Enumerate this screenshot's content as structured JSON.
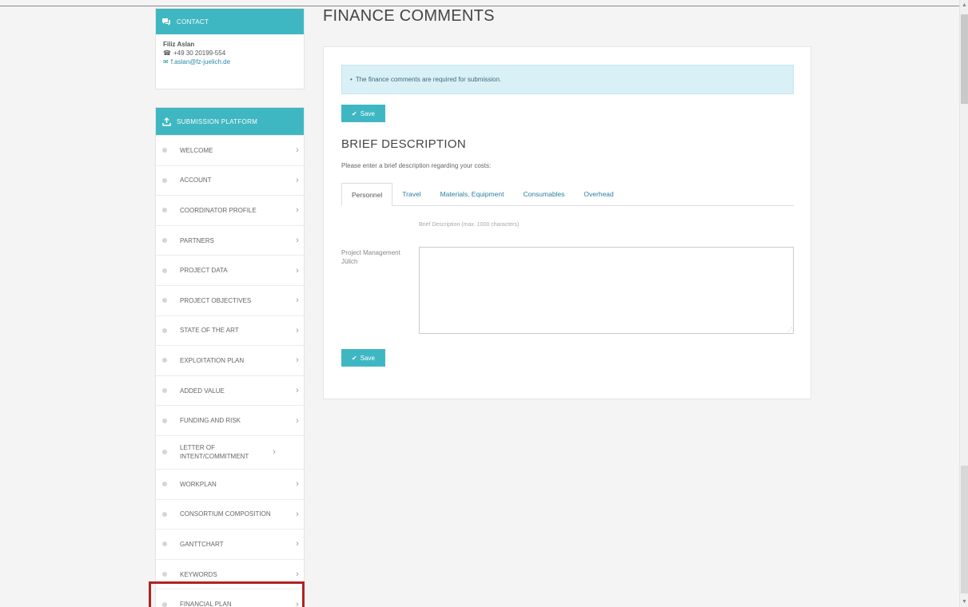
{
  "contact": {
    "header": "CONTACT",
    "header_icon": "chat-icon",
    "name": "Filiz Aslan",
    "phone": "+49 30 20199-554",
    "email": "f.aslan@fz-juelich.de"
  },
  "submission_nav": {
    "header": "SUBMISSION PLATFORM",
    "header_icon": "upload-icon",
    "items": [
      {
        "label": "WELCOME"
      },
      {
        "label": "ACCOUNT"
      },
      {
        "label": "COORDINATOR PROFILE"
      },
      {
        "label": "PARTNERS"
      },
      {
        "label": "PROJECT DATA"
      },
      {
        "label": "PROJECT OBJECTIVES"
      },
      {
        "label": "STATE OF THE ART"
      },
      {
        "label": "EXPLOITATION PLAN"
      },
      {
        "label": "ADDED VALUE"
      },
      {
        "label": "FUNDING AND RISK"
      },
      {
        "label": "LETTER OF INTENT/COMMITMENT"
      },
      {
        "label": "WORKPLAN"
      },
      {
        "label": "CONSORTIUM COMPOSITION"
      },
      {
        "label": "GANTTCHART"
      },
      {
        "label": "KEYWORDS"
      },
      {
        "label": "FINANCIAL PLAN"
      }
    ]
  },
  "main": {
    "title": "FINANCE COMMENTS",
    "alert": "The finance comments are required for submission.",
    "save_label": "Save",
    "section_title": "BRIEF DESCRIPTION",
    "section_desc": "Please enter a brief description regarding your costs:",
    "tabs": [
      {
        "label": "Personnel"
      },
      {
        "label": "Travel"
      },
      {
        "label": "Materials, Equipment"
      },
      {
        "label": "Consumables"
      },
      {
        "label": "Overhead"
      }
    ],
    "active_tab": "Personnel",
    "field_hint": "Brief Description (max. 1000 characters)",
    "field_label": "Project Management Jülich",
    "field_value": ""
  },
  "colors": {
    "accent": "#3fb7c3",
    "alert_bg": "#d9f0f6",
    "link": "#2a7fa4",
    "highlight": "#b22222"
  }
}
